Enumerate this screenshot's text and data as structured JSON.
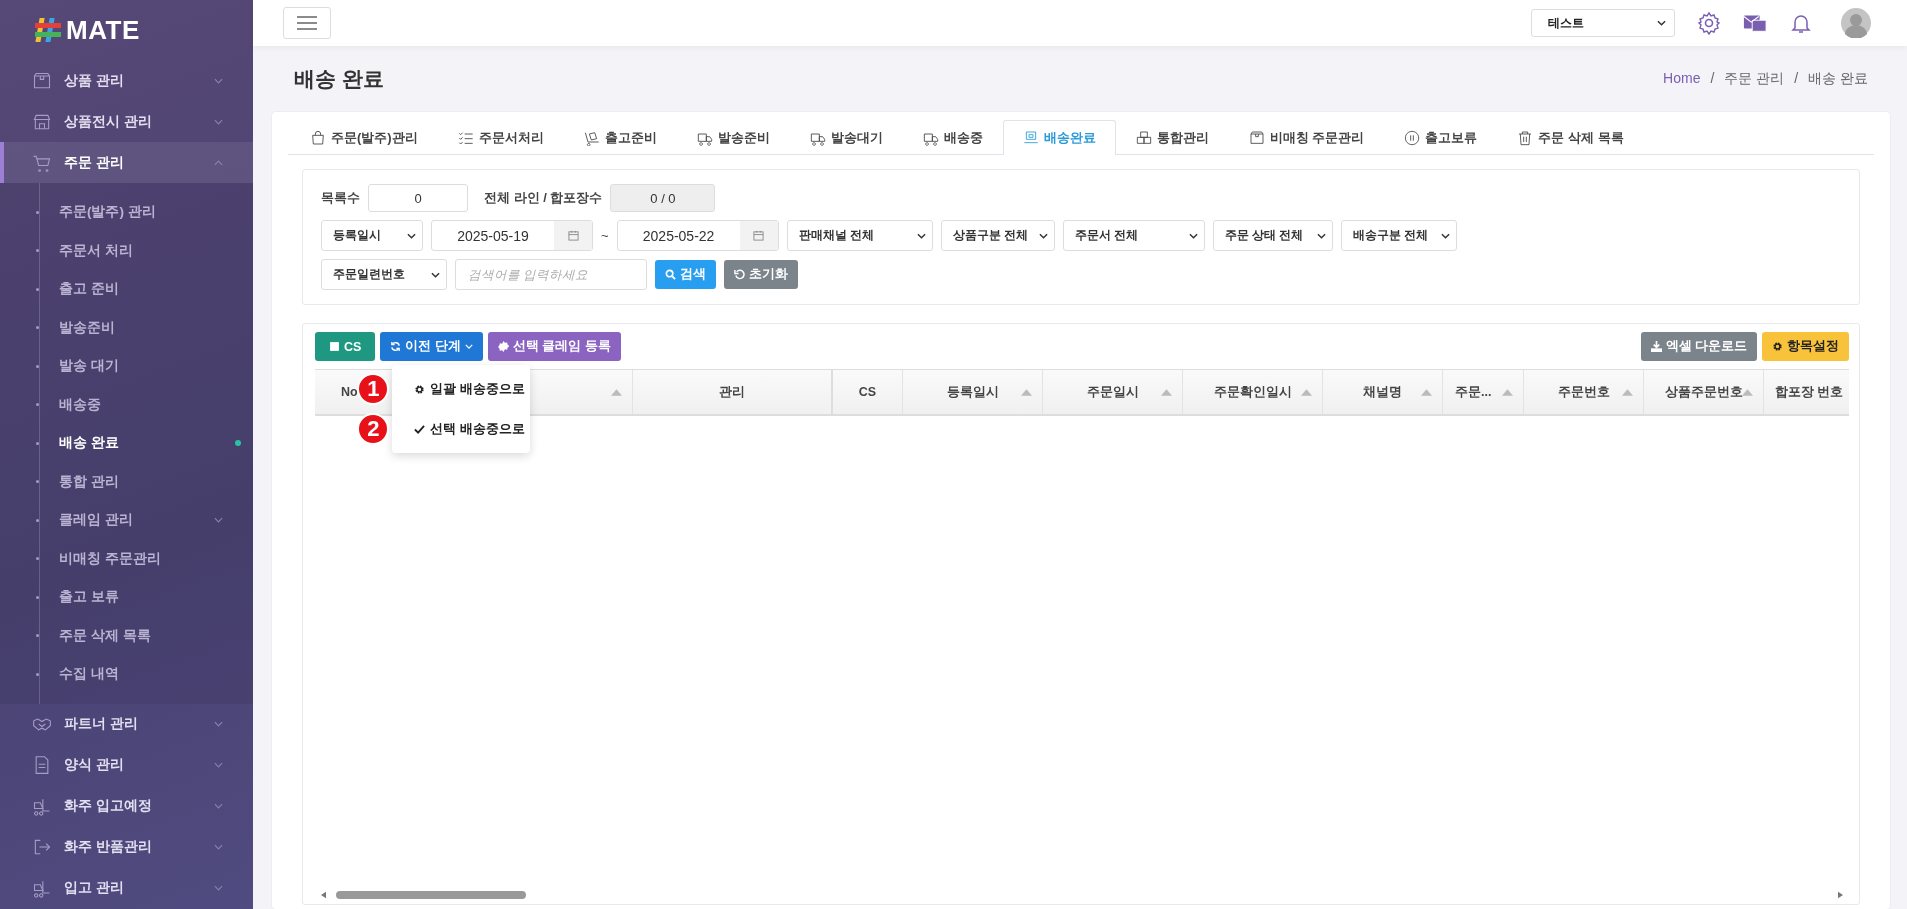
{
  "logo": "MATE",
  "sidebar": {
    "items": [
      {
        "label": "상품 관리",
        "selected": false,
        "expanded": false
      },
      {
        "label": "상품전시 관리",
        "selected": false,
        "expanded": false
      },
      {
        "label": "주문 관리",
        "selected": true,
        "expanded": true,
        "children": [
          {
            "label": "주문(발주) 관리",
            "selected": false,
            "expandable": false
          },
          {
            "label": "주문서 처리",
            "selected": false,
            "expandable": false
          },
          {
            "label": "출고 준비",
            "selected": false,
            "expandable": false
          },
          {
            "label": "발송준비",
            "selected": false,
            "expandable": false
          },
          {
            "label": "발송 대기",
            "selected": false,
            "expandable": false
          },
          {
            "label": "배송중",
            "selected": false,
            "expandable": false
          },
          {
            "label": "배송 완료",
            "selected": true,
            "expandable": false
          },
          {
            "label": "통합 관리",
            "selected": false,
            "expandable": false
          },
          {
            "label": "클레임 관리",
            "selected": false,
            "expandable": true
          },
          {
            "label": "비매칭 주문관리",
            "selected": false,
            "expandable": false
          },
          {
            "label": "출고 보류",
            "selected": false,
            "expandable": false
          },
          {
            "label": "주문 삭제 목록",
            "selected": false,
            "expandable": false
          },
          {
            "label": "수집 내역",
            "selected": false,
            "expandable": false
          }
        ]
      },
      {
        "label": "파트너 관리",
        "selected": false,
        "expanded": false
      },
      {
        "label": "양식 관리",
        "selected": false,
        "expanded": false
      },
      {
        "label": "화주 입고예정",
        "selected": false,
        "expanded": false
      },
      {
        "label": "화주 반품관리",
        "selected": false,
        "expanded": false
      },
      {
        "label": "입고 관리",
        "selected": false,
        "expanded": false
      }
    ]
  },
  "topbar": {
    "company_select": "테스트"
  },
  "page": {
    "title": "배송 완료",
    "breadcrumb": [
      "Home",
      "주문 관리",
      "배송 완료"
    ],
    "breadcrumb_separators": [
      "/",
      "/"
    ]
  },
  "tabs": [
    {
      "label": "주문(발주)관리",
      "selected": false
    },
    {
      "label": "주문서처리",
      "selected": false
    },
    {
      "label": "출고준비",
      "selected": false
    },
    {
      "label": "발송준비",
      "selected": false
    },
    {
      "label": "발송대기",
      "selected": false
    },
    {
      "label": "배송중",
      "selected": false
    },
    {
      "label": "배송완료",
      "selected": true
    },
    {
      "label": "통합관리",
      "selected": false
    },
    {
      "label": "비매칭 주문관리",
      "selected": false
    },
    {
      "label": "출고보류",
      "selected": false
    },
    {
      "label": "주문 삭제 목록",
      "selected": false
    }
  ],
  "filters": {
    "count_label": "목록수",
    "count_value": "0",
    "lines_label": "전체 라인 / 합포장수",
    "lines_value": "0 / 0",
    "date_type": "등록일시",
    "date_from": "2025-05-19",
    "date_sep": "~",
    "date_to": "2025-05-22",
    "selects": [
      "판매채널 전체",
      "상품구분 전체",
      "주문서 전체",
      "주문 상태 전체",
      "배송구분 전체"
    ],
    "search_type": "주문일련번호",
    "search_placeholder": "검색어를 입력하세요",
    "search_button": "검색",
    "reset_button": "초기화"
  },
  "toolbar": {
    "left": [
      {
        "label": "CS",
        "kind": "cs"
      },
      {
        "label": "이전 단계",
        "kind": "dropdown"
      },
      {
        "label": "선택 클레임 등록",
        "kind": "claim"
      }
    ],
    "right": [
      {
        "label": "엑셀 다운로드",
        "kind": "excel"
      },
      {
        "label": "항목설정",
        "kind": "settings"
      }
    ]
  },
  "dropdown": [
    {
      "label": "일괄 배송중으로",
      "marker": "1",
      "kind": "gear"
    },
    {
      "label": "선택 배송중으로",
      "marker": "2",
      "kind": "check"
    }
  ],
  "table": {
    "columns": [
      {
        "label": "No",
        "sortable": true
      },
      {
        "label": "관리",
        "sortable": false
      },
      {
        "label": "CS",
        "sortable": false
      },
      {
        "label": "등록일시",
        "sortable": true
      },
      {
        "label": "주문일시",
        "sortable": true
      },
      {
        "label": "주문확인일시",
        "sortable": true
      },
      {
        "label": "채널명",
        "sortable": true
      },
      {
        "label": "주문...",
        "sortable": true
      },
      {
        "label": "주문번호",
        "sortable": true
      },
      {
        "label": "상품주문번호",
        "sortable": true
      },
      {
        "label": "합포장 번호",
        "sortable": false
      }
    ]
  }
}
